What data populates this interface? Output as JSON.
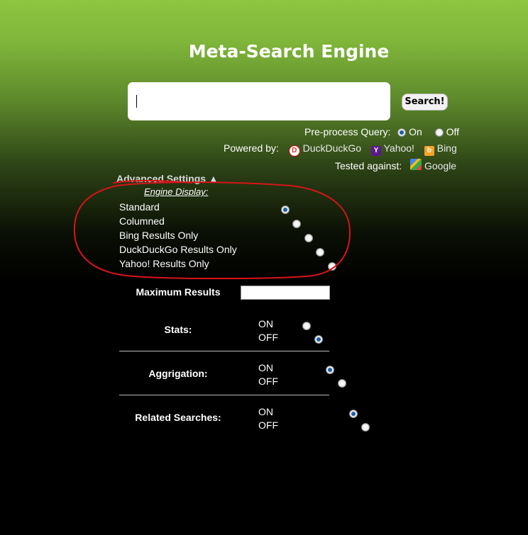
{
  "title": "Meta-Search Engine",
  "search": {
    "value": "",
    "button_label": "Search!"
  },
  "preprocess": {
    "label": "Pre-process Query:",
    "options": [
      "On",
      "Off"
    ],
    "selected": "On"
  },
  "powered_by": {
    "label": "Powered by:",
    "engines": [
      {
        "name": "DuckDuckGo",
        "icon": "duckduckgo-icon"
      },
      {
        "name": "Yahoo!",
        "icon": "yahoo-icon"
      },
      {
        "name": "Bing",
        "icon": "bing-icon"
      }
    ]
  },
  "tested_against": {
    "label": "Tested against:",
    "engine": "Google",
    "icon": "google-icon"
  },
  "advanced": {
    "toggle_label": "Advanced Settings ▲",
    "engine_display_title": "Engine Display:",
    "engine_display_options": [
      "Standard",
      "Columned",
      "Bing Results Only",
      "DuckDuckGo Results Only",
      "Yahoo! Results Only"
    ],
    "engine_display_selected": "Standard",
    "max_results_label": "Maximum Results",
    "max_results_value": "",
    "stats": {
      "label": "Stats:",
      "on": "ON",
      "off": "OFF",
      "selected": "OFF"
    },
    "aggregation": {
      "label": "Aggrigation:",
      "on": "ON",
      "off": "OFF",
      "selected": "ON"
    },
    "related": {
      "label": "Related Searches:",
      "on": "ON",
      "off": "OFF",
      "selected": "ON"
    }
  },
  "colors": {
    "accent": "#8dc63f",
    "annotation": "#d9131a",
    "radio_dot": "#1e5fa8"
  }
}
